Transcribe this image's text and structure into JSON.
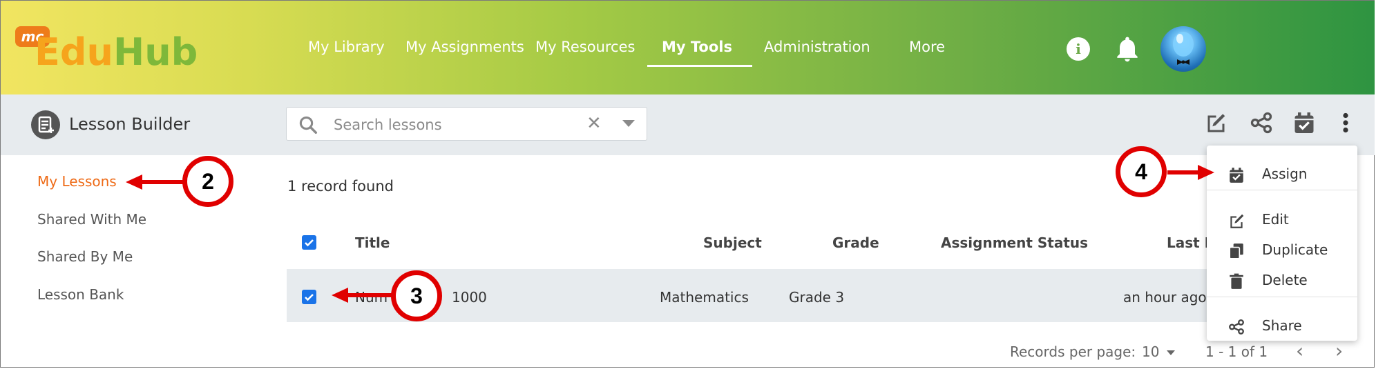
{
  "brand": {
    "badge": "mc",
    "name_part1": "Edu",
    "name_part2": "Hub"
  },
  "nav": {
    "items": [
      "My Library",
      "My Assignments",
      "My Resources",
      "My Tools",
      "Administration",
      "More"
    ],
    "active": "My Tools"
  },
  "header_icons": [
    "info-icon",
    "bell-icon",
    "avatar"
  ],
  "info_glyph": "i",
  "page": {
    "title": "Lesson Builder"
  },
  "search": {
    "placeholder": "Search lessons",
    "clear_glyph": "✕"
  },
  "toolbar_icons": [
    "edit-icon",
    "share-icon",
    "calendar-check-icon",
    "more-vert-icon"
  ],
  "sidebar": {
    "items": [
      "My Lessons",
      "Shared With Me",
      "Shared By Me",
      "Lesson Bank"
    ],
    "active": "My Lessons"
  },
  "table": {
    "records_text": "1 record found",
    "columns": [
      "Title",
      "Subject",
      "Grade",
      "Assignment Status",
      "Last M"
    ],
    "rows": [
      {
        "title_visible_start": "Num",
        "title_visible_end": "1000",
        "subject": "Mathematics",
        "grade": "Grade 3",
        "status": "",
        "last_modified": "an hour ago",
        "checked": true
      }
    ],
    "header_checked": true
  },
  "pagination": {
    "records_per_page_label": "Records per page:",
    "records_per_page": "10",
    "range_text": "1 - 1 of 1",
    "prev_glyph": "‹",
    "next_glyph": "›"
  },
  "more_menu": {
    "items": [
      {
        "label": "Assign",
        "icon": "calendar-check-icon"
      },
      {
        "label": "Edit",
        "icon": "edit-icon"
      },
      {
        "label": "Duplicate",
        "icon": "copy-icon"
      },
      {
        "label": "Delete",
        "icon": "trash-icon"
      },
      {
        "label": "Share",
        "icon": "share-icon"
      }
    ]
  },
  "callouts": [
    "2",
    "3",
    "4"
  ],
  "colors": {
    "accent_orange": "#ee6a16",
    "checkbox_blue": "#1a73e8",
    "callout_red": "#e00000",
    "header_gradient_start": "#f1e561",
    "header_gradient_end": "#2e9441"
  }
}
